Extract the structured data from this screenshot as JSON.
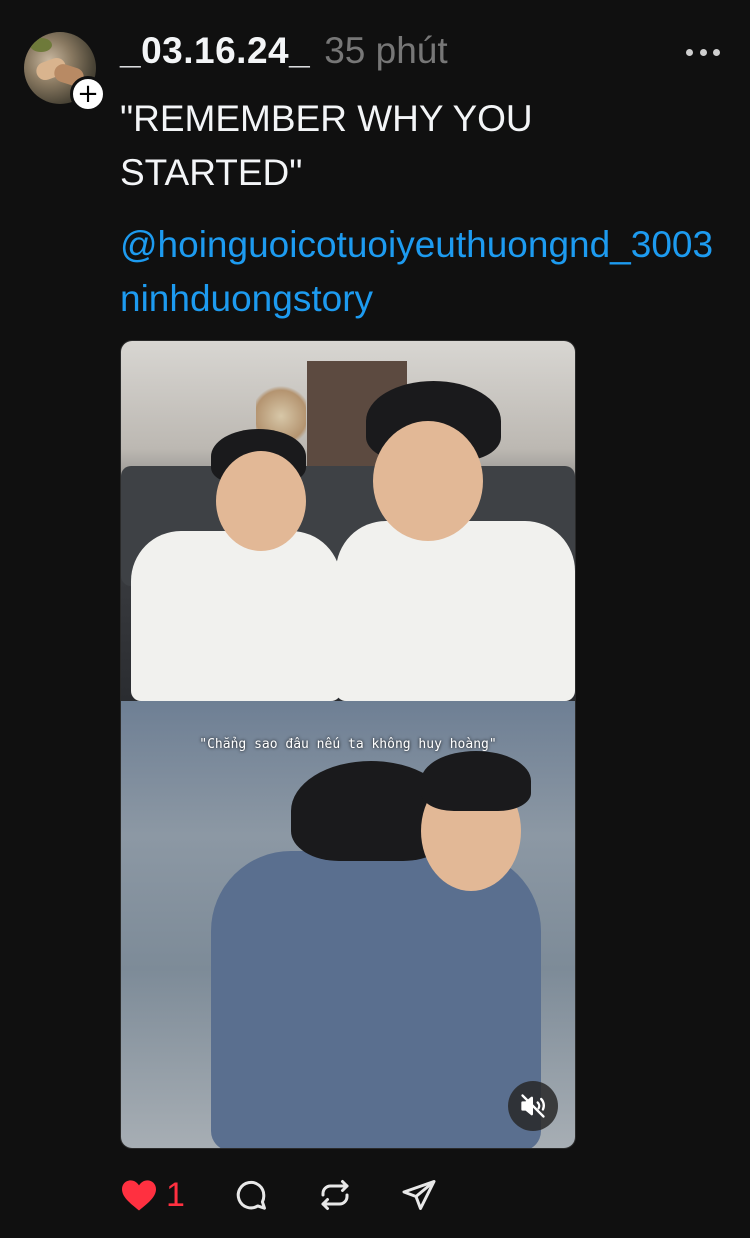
{
  "post": {
    "username": "_03.16.24_",
    "time": "35 phút",
    "caption": "\"REMEMBER WHY YOU STARTED\"",
    "mention": "@hoinguoicotuoiyeuthuongnd_3003",
    "tag": "ninhduongstory",
    "subtitle": "\"Chẳng sao đâu nếu ta không huy hoàng\"",
    "likes": "1"
  },
  "colors": {
    "background": "#101010",
    "link": "#1d9bf0",
    "like": "#ff3040",
    "muted_text": "#777777"
  },
  "icons": {
    "avatar": "avatar",
    "follow": "plus-icon",
    "more": "more-horizontal-icon",
    "mute": "speaker-muted-icon",
    "like": "heart-filled-icon",
    "comment": "comment-icon",
    "repost": "repost-icon",
    "share": "send-icon"
  }
}
